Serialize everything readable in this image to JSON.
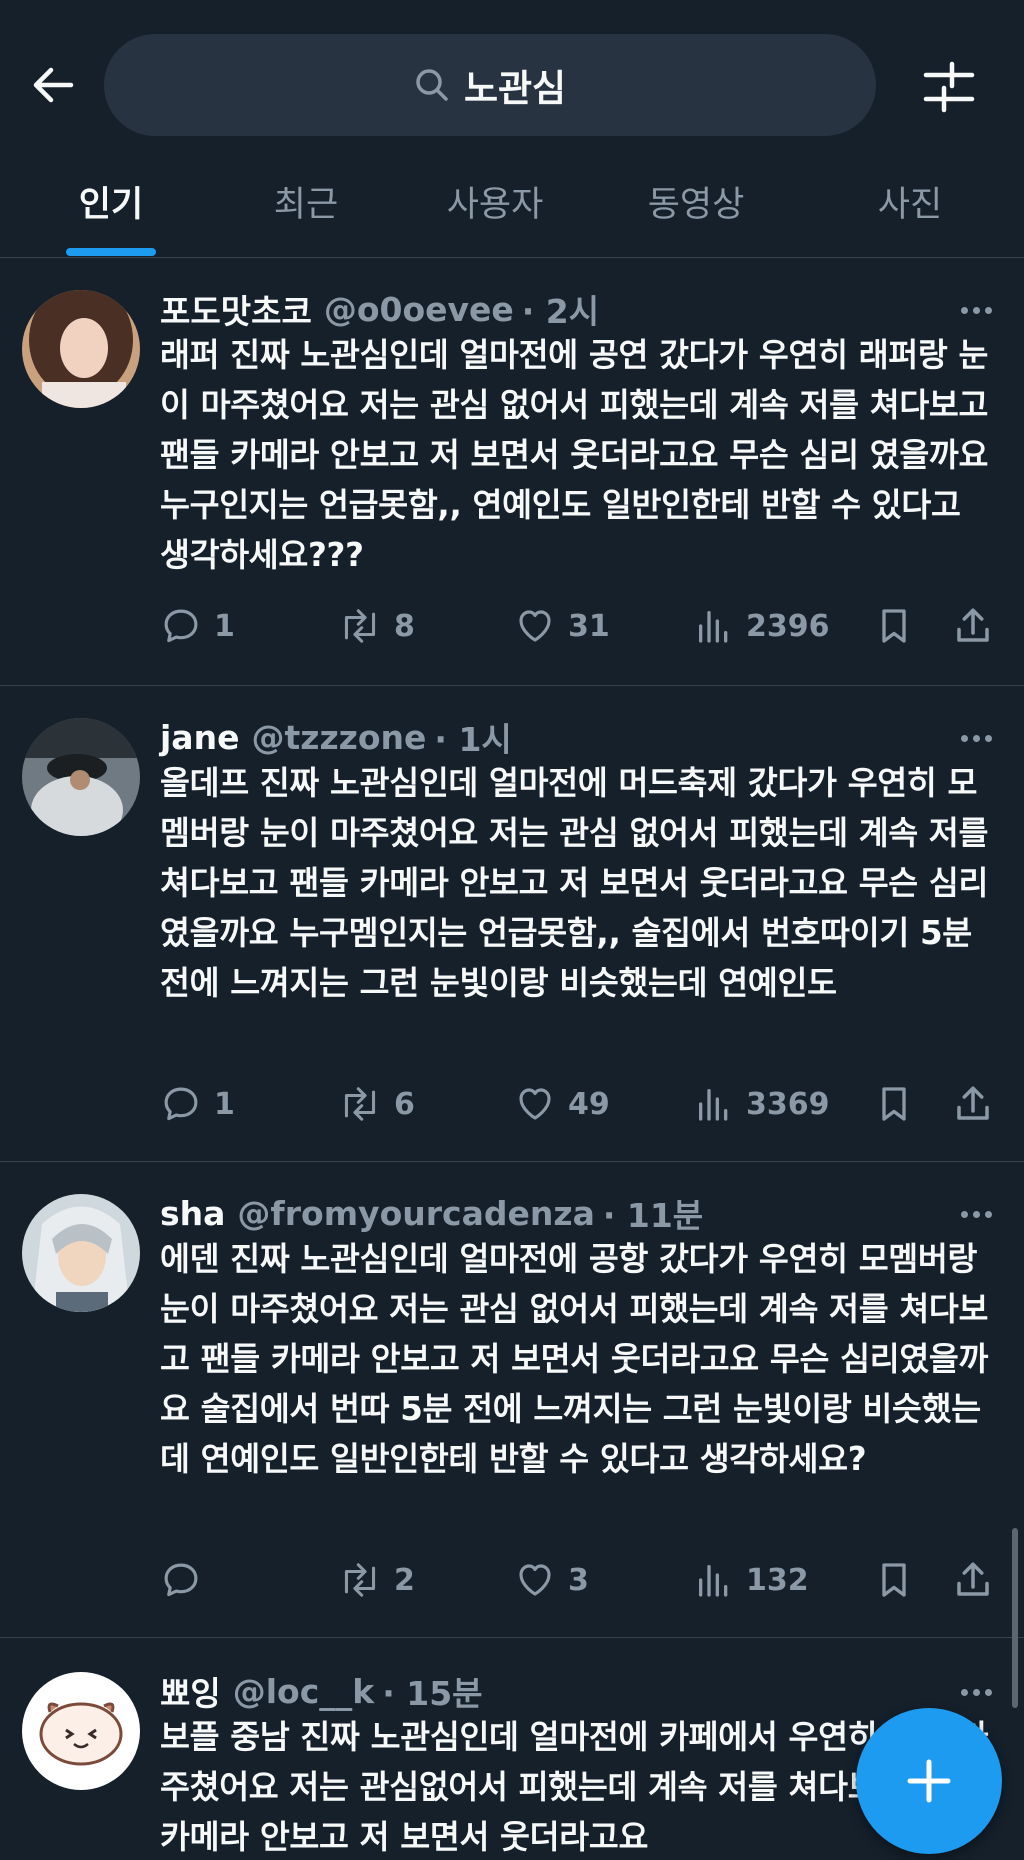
{
  "search": {
    "query": "노관심"
  },
  "tabs": [
    {
      "label": "인기",
      "active": true
    },
    {
      "label": "최근"
    },
    {
      "label": "사용자"
    },
    {
      "label": "동영상"
    },
    {
      "label": "사진"
    }
  ],
  "posts": [
    {
      "name": "포도맛초코",
      "handle": "@o0oevee",
      "time": "· 2시",
      "text": "래퍼 진짜 노관심인데 얼마전에 공연 갔다가 우연히 래퍼랑 눈이 마주쳤어요 저는 관심 없어서 피했는데 계속 저를 쳐다보고 팬들 카메라 안보고 저 보면서 웃더라고요 무슨 심리 였을까요 누구인지는 언급못함,, 연예인도 일반인한테 반할 수 있다고 생각하세요???",
      "replies": "1",
      "reposts": "8",
      "likes": "31",
      "views": "2396"
    },
    {
      "name": "jane",
      "handle": "@tzzzone",
      "time": "· 1시",
      "text": "올데프 진짜 노관심인데 얼마전에 머드축제 갔다가 우연히 모멤버랑 눈이 마주쳤어요 저는 관심 없어서 피했는데 계속 저를 쳐다보고 팬들 카메라 안보고 저 보면서 웃더라고요 무슨 심리였을까요 누구멤인지는 언급못함,, 술집에서 번호따이기 5분 전에 느껴지는 그런 눈빛이랑 비슷했는데 연예인도",
      "replies": "1",
      "reposts": "6",
      "likes": "49",
      "views": "3369"
    },
    {
      "name": "sha",
      "handle": "@fromyourcadenza",
      "time": "· 11분",
      "text": "에덴 진짜 노관심인데 얼마전에 공항 갔다가 우연히 모멤버랑 눈이 마주쳤어요 저는 관심 없어서 피했는데 계속 저를 쳐다보고 팬들 카메라 안보고 저 보면서 웃더라고요 무슨 심리였을까요 술집에서 번따 5분 전에 느껴지는 그런 눈빛이랑 비슷했는데 연예인도 일반인한테 반할 수 있다고 생각하세요?",
      "replies": "",
      "reposts": "2",
      "likes": "3",
      "views": "132"
    },
    {
      "name": "뾰잉",
      "handle": "@loc__k",
      "time": "· 15분",
      "text": "보플 중남 진짜 노관심인데 얼마전에 카페에서 우연히 눈이 마주쳤어요 저는 관심없어서 피했는데 계속 저를 쳐다보고 팬들 카메라 안보고 저 보면서 웃더라고요",
      "replies": "",
      "reposts": "",
      "likes": "",
      "views": ""
    }
  ],
  "colors": {
    "background": "#15202b",
    "accent": "#1d9bf0",
    "muted": "#8b98a5",
    "divider": "#38444d"
  }
}
